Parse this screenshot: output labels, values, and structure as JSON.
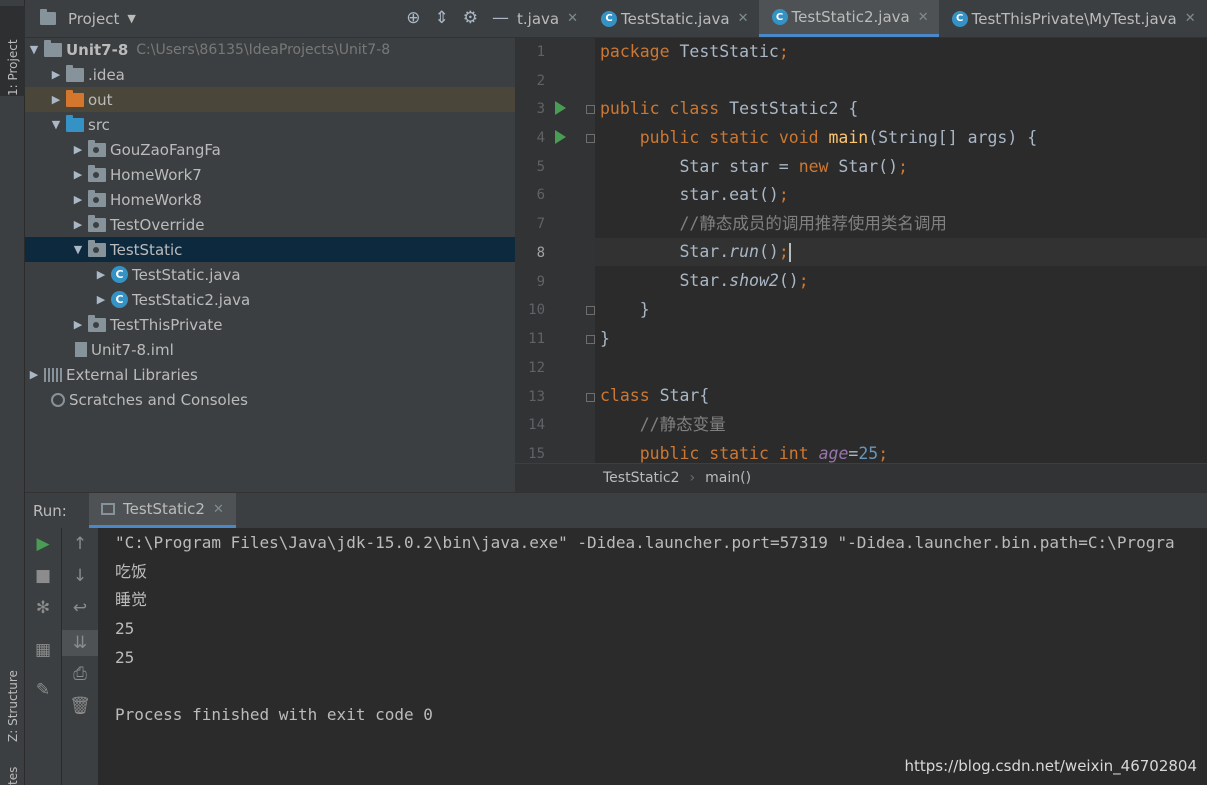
{
  "sidebar": {
    "project_tab": "1: Project",
    "structure_tab": "Z: Structure",
    "favorites_tab": "tes"
  },
  "project": {
    "title": "Project",
    "tree": [
      {
        "label": "Unit7-8",
        "path": "C:\\Users\\86135\\IdeaProjects\\Unit7-8"
      },
      {
        "label": ".idea"
      },
      {
        "label": "out"
      },
      {
        "label": "src"
      },
      {
        "label": "GouZaoFangFa"
      },
      {
        "label": "HomeWork7"
      },
      {
        "label": "HomeWork8"
      },
      {
        "label": "TestOverride"
      },
      {
        "label": "TestStatic"
      },
      {
        "label": "TestStatic.java"
      },
      {
        "label": "TestStatic2.java"
      },
      {
        "label": "TestThisPrivate"
      },
      {
        "label": "Unit7-8.iml"
      },
      {
        "label": "External Libraries"
      },
      {
        "label": "Scratches and Consoles"
      }
    ]
  },
  "editor": {
    "tabs": [
      {
        "label": "t.java"
      },
      {
        "label": "TestStatic.java"
      },
      {
        "label": "TestStatic2.java"
      },
      {
        "label": "TestThisPrivate\\MyTest.java"
      }
    ],
    "line_numbers": [
      "1",
      "2",
      "3",
      "4",
      "5",
      "6",
      "7",
      "8",
      "9",
      "10",
      "11",
      "12",
      "13",
      "14",
      "15"
    ],
    "breadcrumb": {
      "class": "TestStatic2",
      "method": "main()"
    }
  },
  "run": {
    "label": "Run:",
    "tab": "TestStatic2",
    "console": [
      "\"C:\\Program Files\\Java\\jdk-15.0.2\\bin\\java.exe\" -Didea.launcher.port=57319 \"-Didea.launcher.bin.path=C:\\Progra",
      "吃饭",
      "睡觉",
      "25",
      "25",
      "",
      "Process finished with exit code 0"
    ]
  },
  "watermark": "https://blog.csdn.net/weixin_46702804"
}
